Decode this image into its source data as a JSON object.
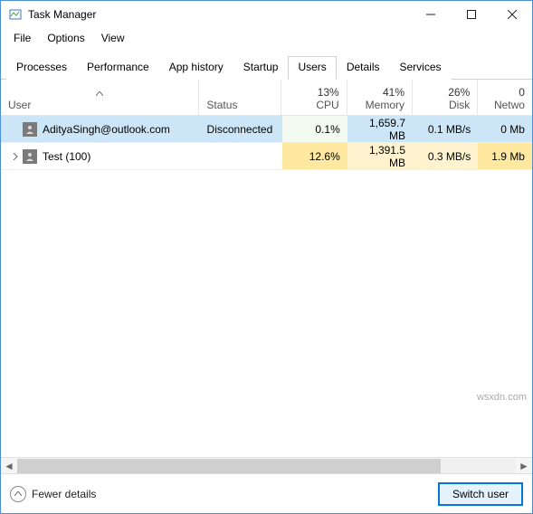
{
  "window": {
    "title": "Task Manager",
    "min": "—",
    "max": "☐",
    "close": "✕"
  },
  "menu": {
    "file": "File",
    "options": "Options",
    "view": "View"
  },
  "tabs": {
    "processes": "Processes",
    "performance": "Performance",
    "apphistory": "App history",
    "startup": "Startup",
    "users": "Users",
    "details": "Details",
    "services": "Services"
  },
  "headers": {
    "user": "User",
    "status": "Status",
    "cpu_pct": "13%",
    "cpu": "CPU",
    "mem_pct": "41%",
    "mem": "Memory",
    "disk_pct": "26%",
    "disk": "Disk",
    "net_pct": "0",
    "net": "Netwo"
  },
  "rows": [
    {
      "user": "AdityaSingh@outlook.com",
      "status": "Disconnected",
      "cpu": "0.1%",
      "mem": "1,659.7 MB",
      "disk": "0.1 MB/s",
      "net": "0 Mb"
    },
    {
      "user": "Test (100)",
      "status": "",
      "cpu": "12.6%",
      "mem": "1,391.5 MB",
      "disk": "0.3 MB/s",
      "net": "1.9 Mb"
    }
  ],
  "footer": {
    "fewer": "Fewer details",
    "switch": "Switch user"
  },
  "watermark": "wsxdn.com"
}
